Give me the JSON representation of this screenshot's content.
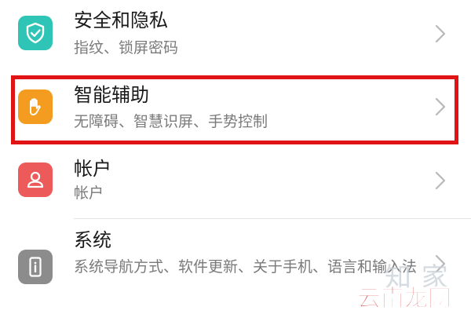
{
  "colors": {
    "security_icon_bg": "#2ec4b6",
    "assist_icon_bg": "#f39c1f",
    "account_icon_bg": "#ec5a5a",
    "system_icon_bg": "#8c8c8c",
    "highlight": "#e01414",
    "watermark_red": "#d62020"
  },
  "settings": {
    "items": [
      {
        "title": "安全和隐私",
        "subtitle": "指纹、锁屏密码",
        "icon": "shield-check-icon"
      },
      {
        "title": "智能辅助",
        "subtitle": "无障碍、智慧识屏、手势控制",
        "icon": "hand-icon"
      },
      {
        "title": "帐户",
        "subtitle": "帐户",
        "icon": "person-icon"
      },
      {
        "title": "系统",
        "subtitle": "系统导航方式、软件更新、关于手机、语言和输入法",
        "icon": "phone-info-icon"
      }
    ]
  },
  "watermark": {
    "light_text": "知 家",
    "brand_text": "云南龙网"
  }
}
